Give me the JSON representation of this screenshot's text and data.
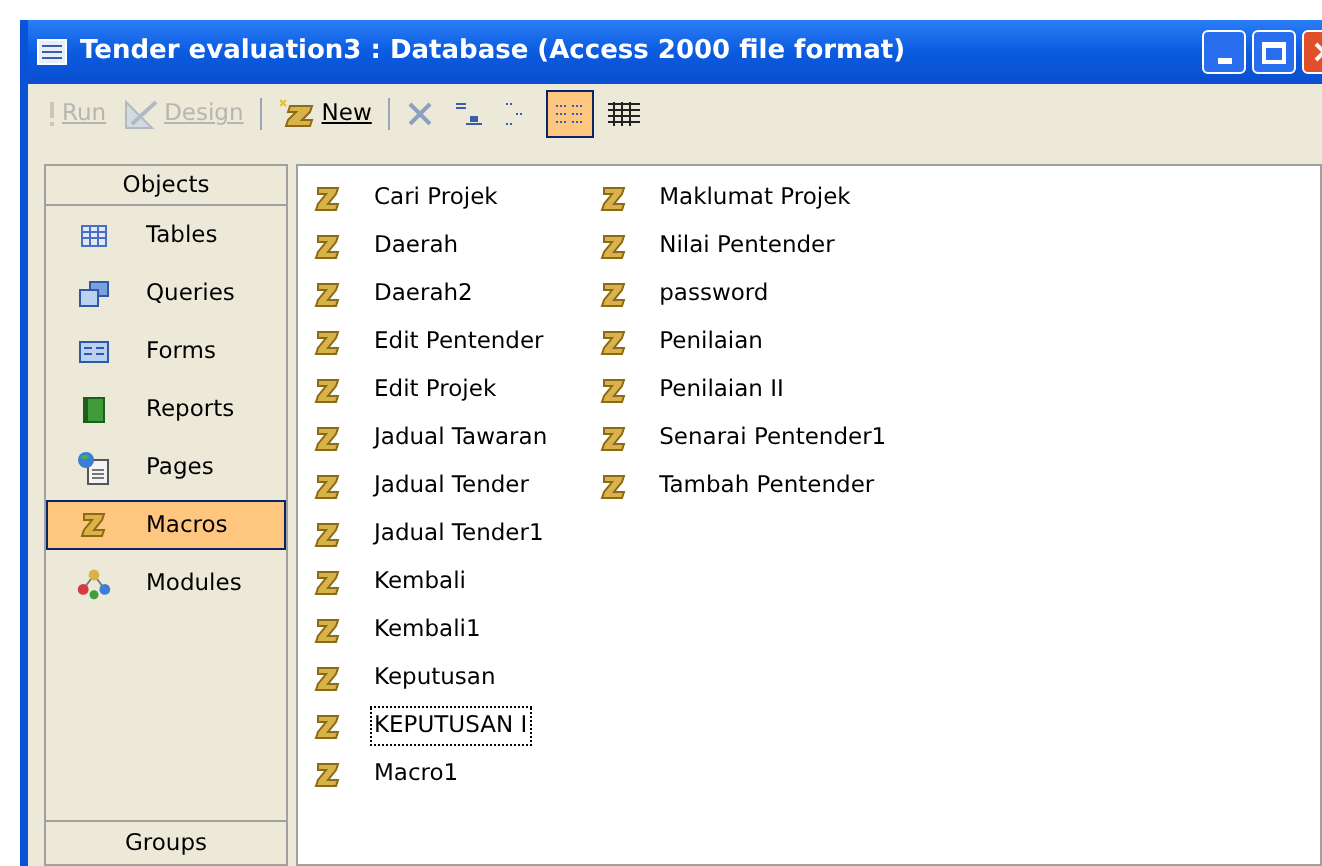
{
  "window": {
    "title": "Tender evaluation3 : Database (Access 2000 file format)"
  },
  "toolbar": [
    {
      "kind": "run",
      "label": "Run",
      "disabled": true,
      "selected": false
    },
    {
      "kind": "design",
      "label": "Design",
      "disabled": true,
      "selected": false
    },
    {
      "kind": "new",
      "label": "New",
      "disabled": false,
      "selected": false
    },
    {
      "kind": "delete",
      "disabled": false,
      "selected": false
    },
    {
      "kind": "large-icons",
      "disabled": false,
      "selected": false
    },
    {
      "kind": "small-icons",
      "disabled": false,
      "selected": false
    },
    {
      "kind": "list",
      "disabled": false,
      "selected": true
    },
    {
      "kind": "details",
      "disabled": false,
      "selected": false
    }
  ],
  "sidebar": {
    "header": "Objects",
    "footer": "Groups",
    "items": [
      {
        "kind": "tables",
        "label": "Tables",
        "selected": false
      },
      {
        "kind": "queries",
        "label": "Queries",
        "selected": false
      },
      {
        "kind": "forms",
        "label": "Forms",
        "selected": false
      },
      {
        "kind": "reports",
        "label": "Reports",
        "selected": false
      },
      {
        "kind": "pages",
        "label": "Pages",
        "selected": false
      },
      {
        "kind": "macros",
        "label": "Macros",
        "selected": true
      },
      {
        "kind": "modules",
        "label": "Modules",
        "selected": false
      }
    ]
  },
  "macros": [
    {
      "name": "Cari Projek",
      "focused": false
    },
    {
      "name": "Daerah",
      "focused": false
    },
    {
      "name": "Daerah2",
      "focused": false
    },
    {
      "name": "Edit Pentender",
      "focused": false
    },
    {
      "name": "Edit Projek",
      "focused": false
    },
    {
      "name": "Jadual Tawaran",
      "focused": false
    },
    {
      "name": "Jadual Tender",
      "focused": false
    },
    {
      "name": "Jadual Tender1",
      "focused": false
    },
    {
      "name": "Kembali",
      "focused": false
    },
    {
      "name": "Kembali1",
      "focused": false
    },
    {
      "name": "Keputusan",
      "focused": false
    },
    {
      "name": "KEPUTUSAN I",
      "focused": true
    },
    {
      "name": "Macro1",
      "focused": false
    },
    {
      "name": "Maklumat Projek",
      "focused": false
    },
    {
      "name": "Nilai Pentender",
      "focused": false
    },
    {
      "name": "password",
      "focused": false
    },
    {
      "name": "Penilaian",
      "focused": false
    },
    {
      "name": "Penilaian II",
      "focused": false
    },
    {
      "name": "Senarai Pentender1",
      "focused": false
    },
    {
      "name": "Tambah Pentender",
      "focused": false
    }
  ]
}
